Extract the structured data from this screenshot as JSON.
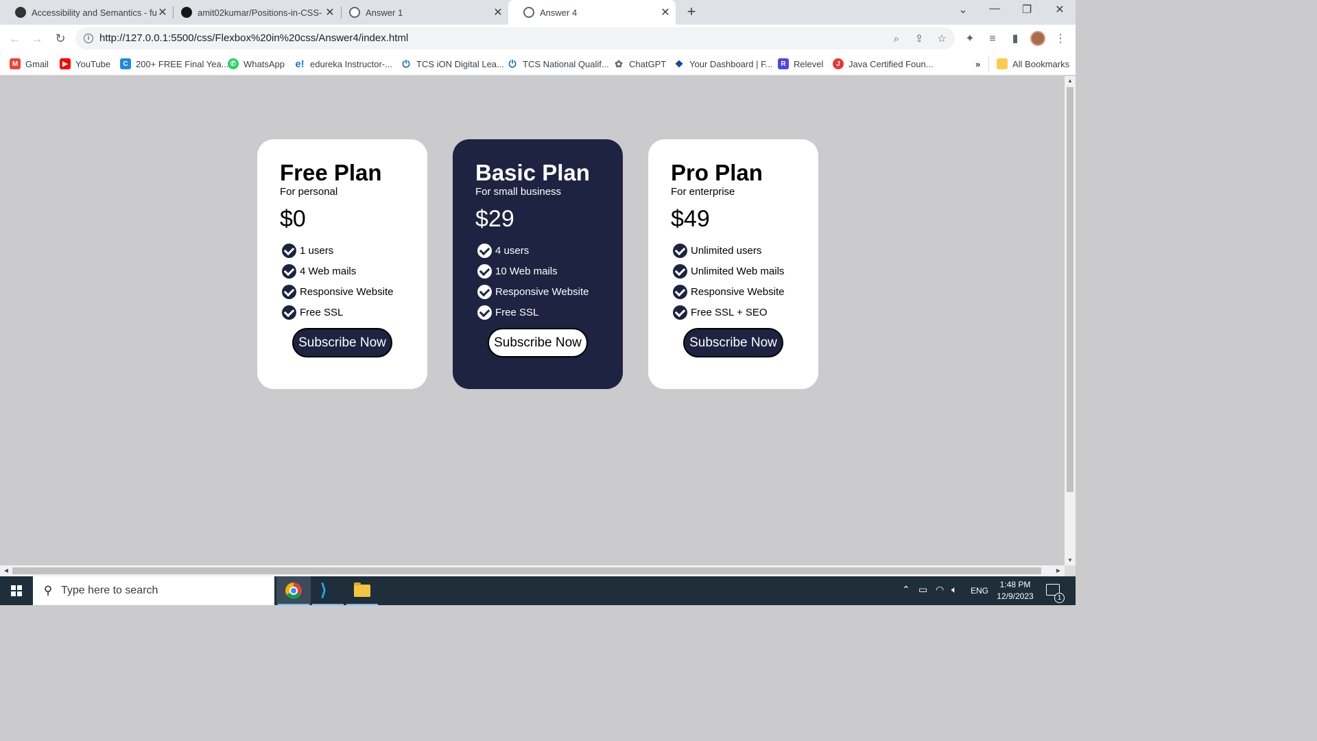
{
  "browser": {
    "tabs": [
      {
        "title": "Accessibility and Semantics - ful",
        "favicon_color": "#333333"
      },
      {
        "title": "amit02kumar/Positions-in-CSS-",
        "favicon_color": "#181717"
      },
      {
        "title": "Answer 1",
        "favicon_color": "#5f6368"
      },
      {
        "title": "Answer 4",
        "favicon_color": "#5f6368"
      }
    ],
    "url": "http://127.0.0.1:5500/css/Flexbox%20in%20css/Answer4/index.html",
    "bookmarks": [
      {
        "label": "Gmail",
        "icon": "gmail-icon",
        "color": "#ea4335"
      },
      {
        "label": "YouTube",
        "icon": "youtube-icon",
        "color": "#ff0000"
      },
      {
        "label": "200+ FREE Final Yea...",
        "icon": "c-logo-icon",
        "color": "#1e88e5"
      },
      {
        "label": "WhatsApp",
        "icon": "whatsapp-icon",
        "color": "#25d366"
      },
      {
        "label": "edureka Instructor-...",
        "icon": "edureka-icon",
        "color": "#1a73e8"
      },
      {
        "label": "TCS iON Digital Lea...",
        "icon": "power-icon",
        "color": "#1565c0"
      },
      {
        "label": "TCS National Qualif...",
        "icon": "power-icon",
        "color": "#1565c0"
      },
      {
        "label": "ChatGPT",
        "icon": "chatgpt-icon",
        "color": "#6b6b6b"
      },
      {
        "label": "Your Dashboard | F...",
        "icon": "dashboard-icon",
        "color": "#0d47a1"
      },
      {
        "label": "Relevel",
        "icon": "relevel-icon",
        "color": "#4f46e5"
      },
      {
        "label": "Java Certified Foun...",
        "icon": "java-icon",
        "color": "#e53935"
      }
    ],
    "bookmarks_overflow": "»",
    "all_bookmarks": "All Bookmarks"
  },
  "plans": [
    {
      "name": "Free Plan",
      "subtitle": "For personal",
      "price": "$0",
      "features": [
        "1 users",
        "4 Web mails",
        "Responsive Website",
        "Free SSL"
      ],
      "button": "Subscribe Now",
      "theme": "light"
    },
    {
      "name": "Basic Plan",
      "subtitle": "For small business",
      "price": "$29",
      "features": [
        "4 users",
        "10 Web mails",
        "Responsive Website",
        "Free SSL"
      ],
      "button": "Subscribe Now",
      "theme": "dark"
    },
    {
      "name": "Pro Plan",
      "subtitle": "For enterprise",
      "price": "$49",
      "features": [
        "Unlimited users",
        "Unlimited Web mails",
        "Responsive Website",
        "Free SSL + SEO"
      ],
      "button": "Subscribe Now",
      "theme": "light"
    }
  ],
  "colors": {
    "page_bg": "#cbcacc",
    "card_dark": "#1d2340",
    "card_light": "#ffffff"
  },
  "taskbar": {
    "search_placeholder": "Type here to search",
    "language": "ENG",
    "time": "1:48 PM",
    "date": "12/9/2023",
    "notification_count": "1"
  }
}
